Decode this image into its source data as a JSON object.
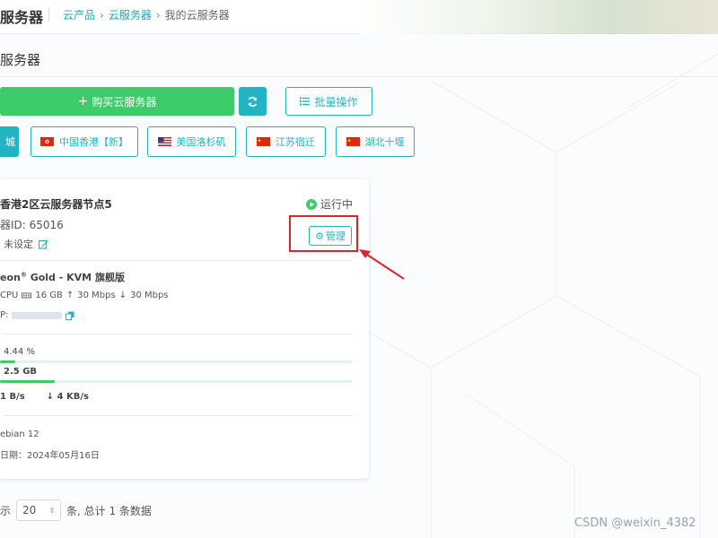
{
  "header": {
    "app_title": "服务器",
    "breadcrumb": {
      "item1": "云产品",
      "item2": "云服务器",
      "item3": "我的云服务器"
    }
  },
  "section": {
    "title": "服务器"
  },
  "toolbar": {
    "buy_label": "购买云服务器",
    "batch_label": "批量操作"
  },
  "regions": {
    "active_label": "城",
    "items": [
      {
        "label": "中国香港【新】",
        "flag": "hk"
      },
      {
        "label": "美国洛杉矶",
        "flag": "us"
      },
      {
        "label": "江苏宿迁",
        "flag": "cn"
      },
      {
        "label": "湖北十堰",
        "flag": "cn"
      }
    ]
  },
  "server": {
    "name": "香港2区云服务器节点5",
    "status": "运行中",
    "id_text": "器ID: 65016",
    "remark": "未设定",
    "manage_label": "管理",
    "cpu_prefix": "eon",
    "cpu_reg": "®",
    "cpu_model": " Gold - KVM 旗舰版",
    "spec_cpu": "CPU",
    "spec_memory": "16 GB",
    "spec_up": "30 Mbps",
    "spec_down": "30 Mbps",
    "ip_label": "P:",
    "cpu_usage_text": "4.44 %",
    "cpu_usage_value": 0.0444,
    "mem_usage_text": "2.5 GB",
    "mem_usage_fraction": 0.156,
    "net_up": "1 B/s",
    "net_down": "4 KB/s",
    "os": "ebian 12",
    "expiry": "日期：2024年05月16日"
  },
  "pagination": {
    "prefix": "示",
    "page_size": "20",
    "summary": "条, 总计 1 条数据"
  },
  "watermark": "CSDN @weixin_4382",
  "colors": {
    "accent": "#23b4c4",
    "buy_green": "#3ecb6a",
    "highlight_red": "#d9252f"
  }
}
